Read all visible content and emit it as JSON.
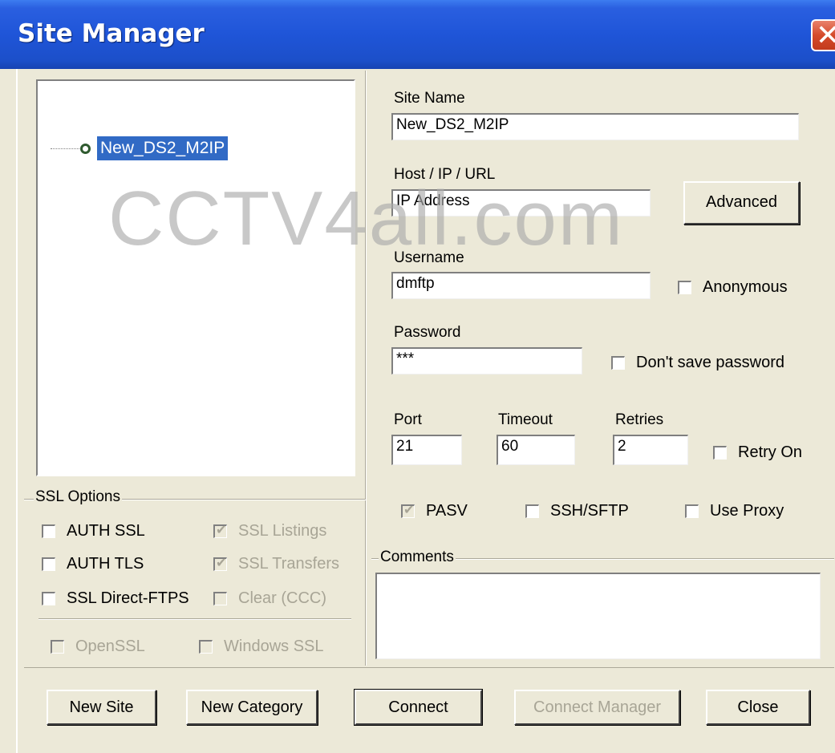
{
  "window": {
    "title": "Site Manager",
    "close_glyph": "✕"
  },
  "tree": {
    "items": [
      {
        "label": "New_DS2_M2IP",
        "icon": "site-node-icon",
        "selected": true
      }
    ]
  },
  "form": {
    "site_name": {
      "label": "Site Name",
      "value": "New_DS2_M2IP"
    },
    "host": {
      "label": "Host / IP / URL",
      "value": "IP Address",
      "advanced_label": "Advanced"
    },
    "username": {
      "label": "Username",
      "value": "dmftp",
      "anonymous_label": "Anonymous",
      "anonymous_checked": false
    },
    "password": {
      "label": "Password",
      "value": "***",
      "dont_save_label": "Don't save password",
      "dont_save_checked": false
    },
    "port": {
      "label": "Port",
      "value": "21"
    },
    "timeout": {
      "label": "Timeout",
      "value": "60"
    },
    "retries": {
      "label": "Retries",
      "value": "2"
    },
    "retry_on": {
      "label": "Retry On",
      "checked": false
    },
    "pasv": {
      "label": "PASV",
      "checked": true,
      "disabled": true
    },
    "ssh_sftp": {
      "label": "SSH/SFTP",
      "checked": false
    },
    "use_proxy": {
      "label": "Use Proxy",
      "checked": false
    },
    "comments": {
      "label": "Comments",
      "value": ""
    }
  },
  "ssl": {
    "group_label": "SSL Options",
    "auth_ssl": {
      "label": "AUTH SSL",
      "checked": false
    },
    "auth_tls": {
      "label": "AUTH TLS",
      "checked": false
    },
    "ssl_direct": {
      "label": "SSL Direct-FTPS",
      "checked": false
    },
    "ssl_listings": {
      "label": "SSL Listings",
      "checked": true,
      "disabled": true
    },
    "ssl_transfers": {
      "label": "SSL Transfers",
      "checked": true,
      "disabled": true
    },
    "clear_ccc": {
      "label": "Clear (CCC)",
      "checked": false,
      "disabled": true
    },
    "openssl": {
      "label": "OpenSSL",
      "checked": false,
      "disabled": true
    },
    "windows_ssl": {
      "label": "Windows SSL",
      "checked": false,
      "disabled": true
    }
  },
  "buttons": {
    "new_site": "New Site",
    "new_category": "New Category",
    "connect": "Connect",
    "connect_manager": "Connect Manager",
    "close": "Close"
  },
  "watermark": "CCTV4all.com",
  "colors": {
    "titlebar": "#1f55d8",
    "dialog_bg": "#ece9d8",
    "selection": "#316ac5",
    "close_red": "#d54a2b"
  }
}
